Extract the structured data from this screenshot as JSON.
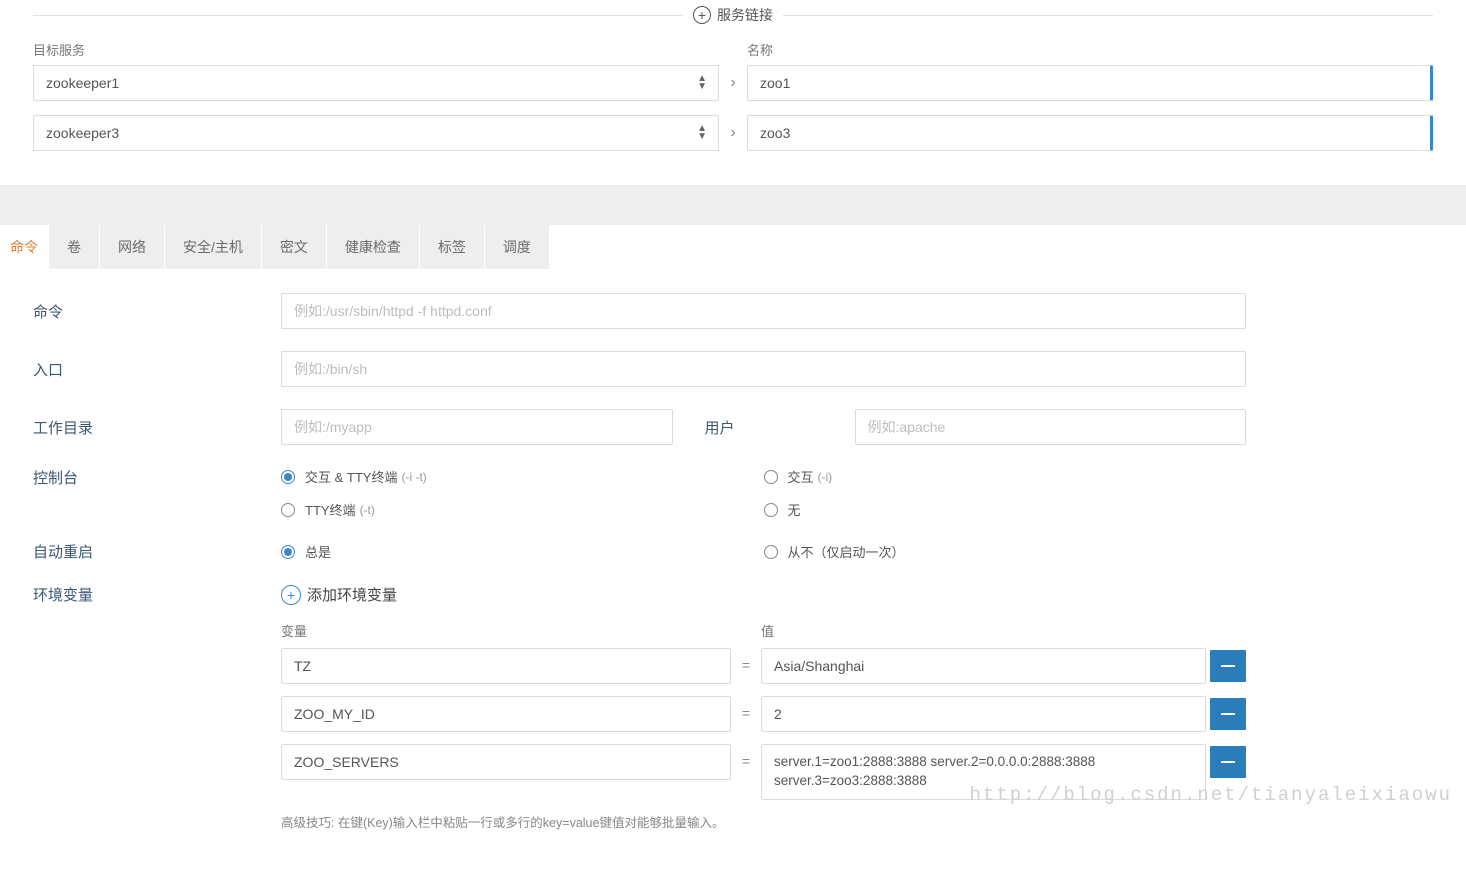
{
  "serviceLinks": {
    "title": "服务链接",
    "targetLabel": "目标服务",
    "nameLabel": "名称",
    "rows": [
      {
        "target": "zookeeper1",
        "name": "zoo1"
      },
      {
        "target": "zookeeper3",
        "name": "zoo3"
      }
    ]
  },
  "tabs": {
    "items": [
      "命令",
      "卷",
      "网络",
      "安全/主机",
      "密文",
      "健康检查",
      "标签",
      "调度"
    ],
    "activeIndex": 0
  },
  "commandForm": {
    "commandLabel": "命令",
    "commandPlaceholder": "例如:/usr/sbin/httpd -f httpd.conf",
    "entryLabel": "入口",
    "entryPlaceholder": "例如:/bin/sh",
    "workdirLabel": "工作目录",
    "workdirPlaceholder": "例如:/myapp",
    "userLabel": "用户",
    "userPlaceholder": "例如:apache",
    "consoleLabel": "控制台",
    "consoleOptions": {
      "opt1": "交互 & TTY终端",
      "opt1Suffix": "(-i -t)",
      "opt2": "交互",
      "opt2Suffix": "(-i)",
      "opt3": "TTY终端",
      "opt3Suffix": "(-t)",
      "opt4": "无"
    },
    "restartLabel": "自动重启",
    "restartOptions": {
      "always": "总是",
      "never": "从不（仅启动一次）"
    },
    "envLabel": "环境变量",
    "addEnvLabel": "添加环境变量",
    "envVarHeader": "变量",
    "envValHeader": "值",
    "envRows": [
      {
        "key": "TZ",
        "value": "Asia/Shanghai"
      },
      {
        "key": "ZOO_MY_ID",
        "value": "2"
      },
      {
        "key": "ZOO_SERVERS",
        "value": "server.1=zoo1:2888:3888 server.2=0.0.0.0:2888:3888 server.3=zoo3:2888:3888"
      }
    ],
    "tip": "高级技巧: 在键(Key)输入栏中粘贴一行或多行的key=value键值对能够批量输入。"
  },
  "watermark": "http://blog.csdn.net/tianyaleixiaowu"
}
